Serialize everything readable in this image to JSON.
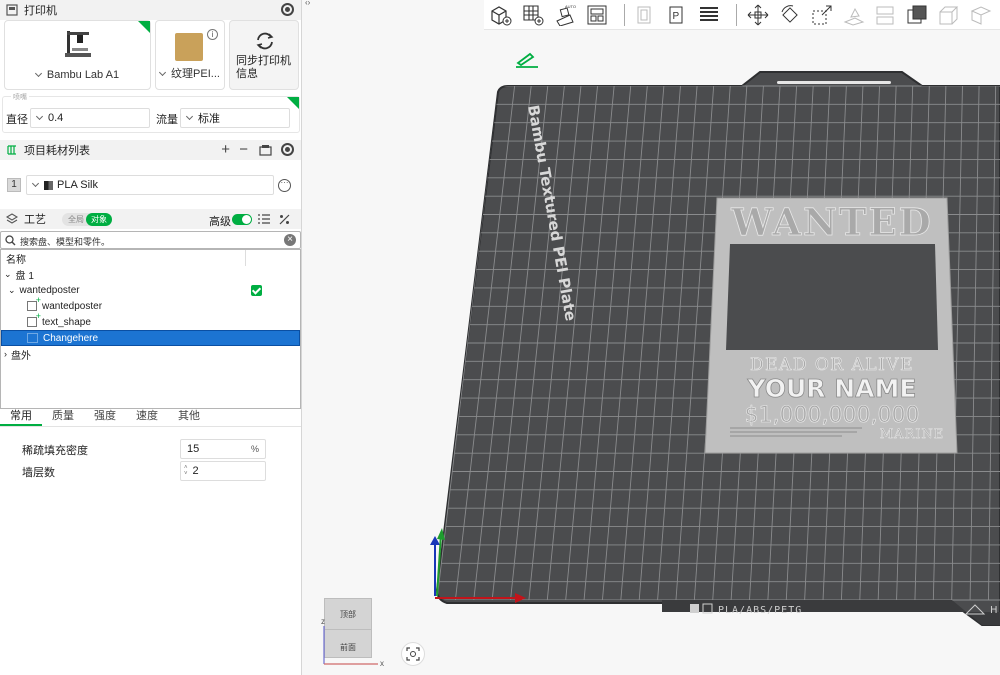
{
  "printer_section": {
    "title": "打印机",
    "printer_name": "Bambu Lab A1",
    "plate_type": "纹理PEI...",
    "sync_button": "同步打印机\n信息"
  },
  "nozzle": {
    "group_label": "喷嘴",
    "diameter_label": "直径",
    "diameter_value": "0.4",
    "flow_label": "流量",
    "flow_value": "标准"
  },
  "filament_section": {
    "title": "项目耗材列表",
    "slot_number": "1",
    "filament_name": "PLA Silk"
  },
  "process_section": {
    "title": "工艺",
    "toggle_global": "全局",
    "toggle_object": "对象",
    "advanced_label": "高级"
  },
  "search": {
    "placeholder": "搜索盘、模型和零件。"
  },
  "object_tree": {
    "header": "名称",
    "plate": "盘 1",
    "object": "wantedposter",
    "parts": [
      "wantedposter",
      "text_shape",
      "Changehere"
    ],
    "outside": "盘外"
  },
  "settings_tabs": [
    "常用",
    "质量",
    "强度",
    "速度",
    "其他"
  ],
  "settings": {
    "infill_label": "稀疏填充密度",
    "infill_value": "15",
    "infill_unit": "%",
    "walls_label": "墙层数",
    "walls_value": "2"
  },
  "plate": {
    "brand_text": "Bambu Textured PEI Plate",
    "bottom_text": "PLA/ABS/PETG",
    "corner_text": "H"
  },
  "poster": {
    "title": "WANTED",
    "subtitle": "DEAD OR ALIVE",
    "name": "YOUR NAME",
    "reward": "$1,000,000,000",
    "small_text": "MARINE"
  },
  "view_cube": {
    "top": "顶部",
    "front": "前面",
    "axis_x": "x",
    "axis_z": "z"
  },
  "colors": {
    "accent": "#00ae42",
    "selection": "#1c74d2",
    "bed": "#4b4c4e",
    "grid": "#8a8b8d"
  }
}
